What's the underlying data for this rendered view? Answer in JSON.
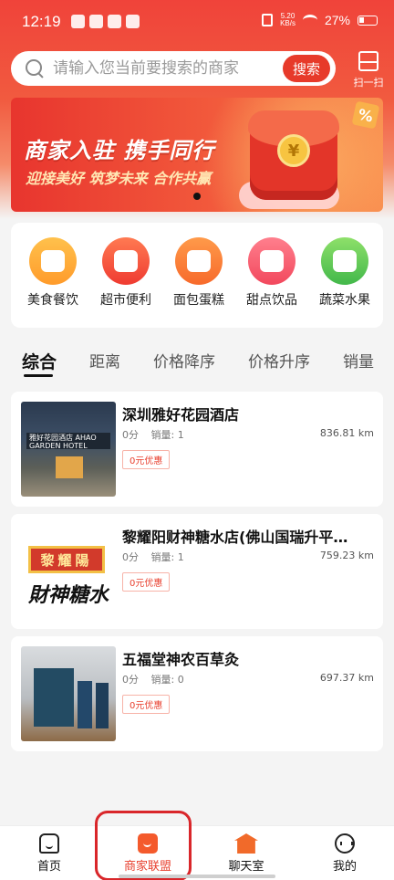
{
  "status": {
    "time": "12:19",
    "speed_value": "5.20",
    "speed_unit": "KB/s",
    "battery": "27%"
  },
  "search": {
    "placeholder": "请输入您当前要搜索的商家",
    "button_label": "搜索"
  },
  "scan": {
    "label": "扫一扫",
    "icon": "scan-icon"
  },
  "banner": {
    "title": "商家入驻 携手同行",
    "subtitle": "迎接美好 筑梦未来 合作共赢",
    "coin_symbol": "¥",
    "tag": "%"
  },
  "categories": [
    {
      "label": "美食餐饮",
      "icon": "food-icon",
      "color": "#ffab36"
    },
    {
      "label": "超市便利",
      "icon": "supermarket-icon",
      "color": "#f2483a"
    },
    {
      "label": "面包蛋糕",
      "icon": "bread-icon",
      "color": "#f97e39"
    },
    {
      "label": "甜点饮品",
      "icon": "dessert-icon",
      "color": "#f45a6c"
    },
    {
      "label": "蔬菜水果",
      "icon": "vegetable-icon",
      "color": "#55c255"
    }
  ],
  "sort_tabs": [
    {
      "label": "综合",
      "active": true
    },
    {
      "label": "距离"
    },
    {
      "label": "价格降序"
    },
    {
      "label": "价格升序"
    },
    {
      "label": "销量"
    }
  ],
  "shops": [
    {
      "name": "深圳雅好花园酒店",
      "score": "0分",
      "sales": "销量: 1",
      "distance": "836.81 km",
      "coupon": "0元优惠",
      "image_text": "雅好花园酒店 AHAO GARDEN HOTEL"
    },
    {
      "name": "黎耀阳财神糖水店(佛山国瑞升平…",
      "score": "0分",
      "sales": "销量: 1",
      "distance": "759.23 km",
      "coupon": "0元优惠",
      "image_text": "黎耀陽",
      "image_text2": "財神糖水"
    },
    {
      "name": "五福堂神农百草灸",
      "score": "0分",
      "sales": "销量: 0",
      "distance": "697.37 km",
      "coupon": "0元优惠"
    }
  ],
  "bottom_nav": [
    {
      "label": "首页",
      "icon": "home-icon"
    },
    {
      "label": "商家联盟",
      "icon": "shopping-bag-icon",
      "active": true
    },
    {
      "label": "聊天室",
      "icon": "chat-room-icon"
    },
    {
      "label": "我的",
      "icon": "profile-icon"
    }
  ],
  "colors": {
    "accent": "#e8402f",
    "header": "#f0433a"
  }
}
